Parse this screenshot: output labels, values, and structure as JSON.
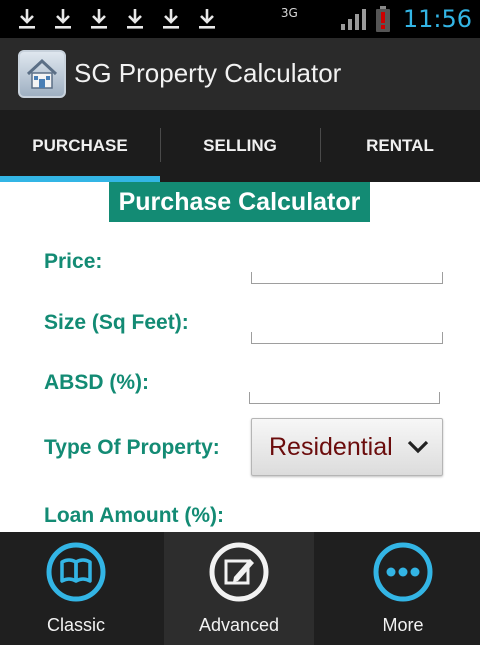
{
  "status_bar": {
    "notifications": [
      "download-icon",
      "download-icon",
      "download-icon",
      "download-icon",
      "download-icon",
      "download-icon"
    ],
    "network": "3G",
    "time": "11:56",
    "colors": {
      "clock": "#33b5e5",
      "battery_alert": "#cc0000"
    }
  },
  "action_bar": {
    "title": "SG Property Calculator",
    "logo_icon": "house-app-icon"
  },
  "tabs": [
    {
      "label": "PURCHASE",
      "selected": true
    },
    {
      "label": "SELLING",
      "selected": false
    },
    {
      "label": "RENTAL",
      "selected": false
    }
  ],
  "form": {
    "heading": "Purchase Calculator",
    "price_label": "Price:",
    "price_value": "",
    "size_label": "Size (Sq Feet):",
    "size_value": "",
    "absd_label": "ABSD (%):",
    "absd_value": "",
    "property_type_label": "Type Of Property:",
    "property_type_value": "Residential",
    "loan_label": "Loan Amount (%):"
  },
  "bottom_nav": [
    {
      "label": "Classic",
      "icon": "book-icon",
      "active": false
    },
    {
      "label": "Advanced",
      "icon": "edit-icon",
      "active": true
    },
    {
      "label": "More",
      "icon": "more-dots-icon",
      "active": false
    }
  ],
  "colors": {
    "accent": "#33b5e5",
    "label_green": "#138b74",
    "spinner_text": "#6b0c0c"
  }
}
